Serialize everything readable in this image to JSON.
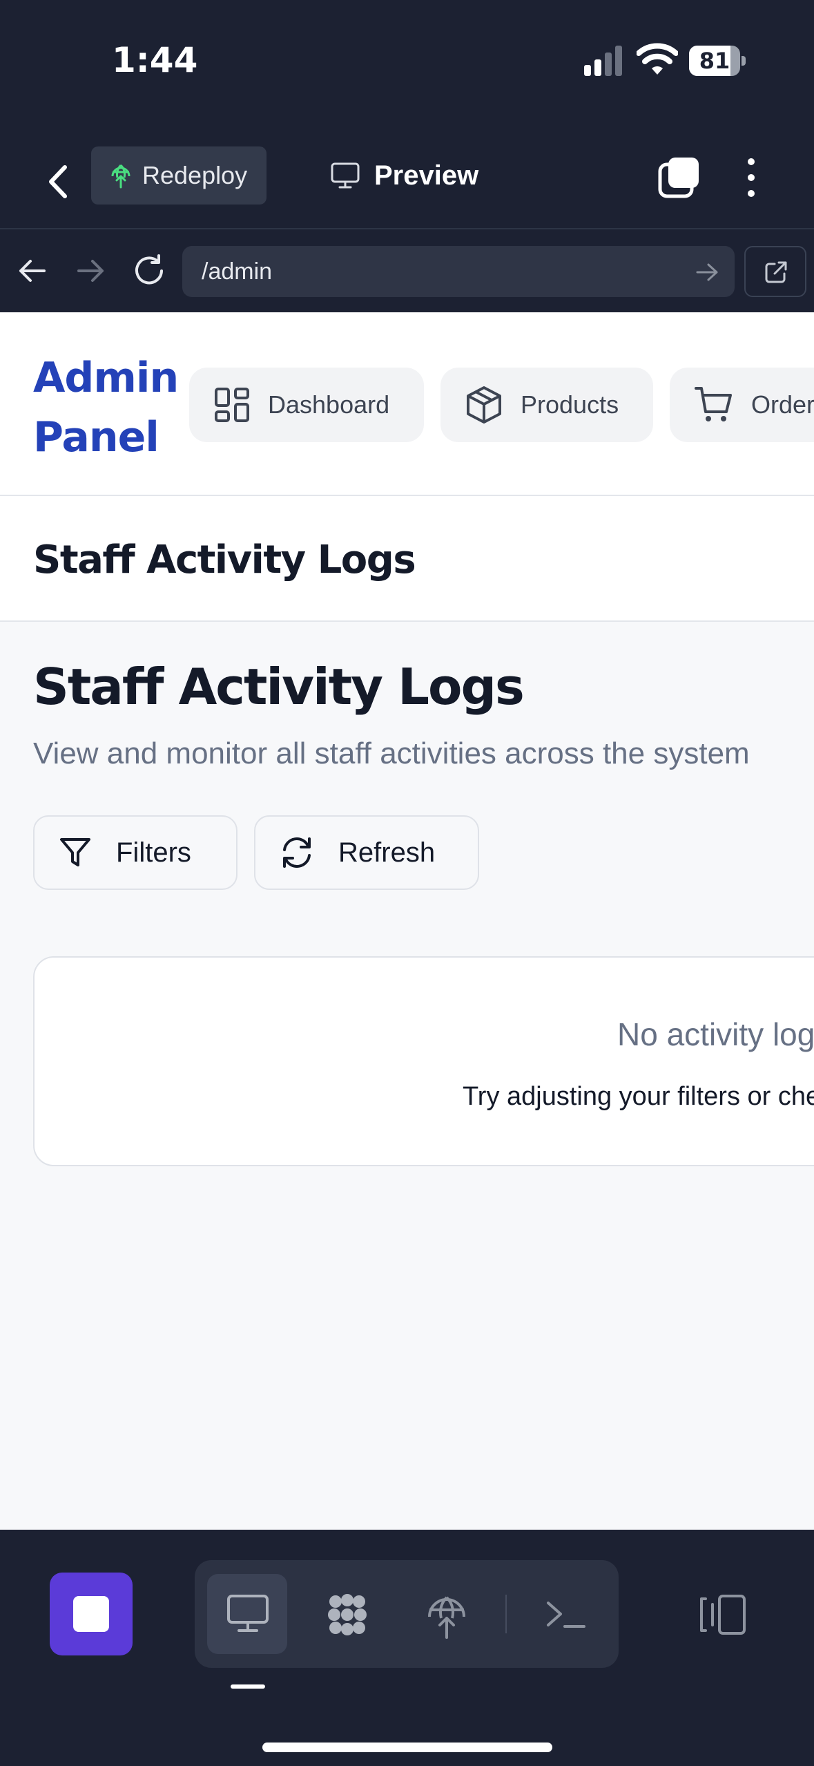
{
  "status_bar": {
    "time": "1:44",
    "battery": "81",
    "battery_level": 0.81
  },
  "toolbar": {
    "redeploy_label": "Redeploy",
    "preview_label": "Preview"
  },
  "browser": {
    "url": "/admin"
  },
  "site": {
    "brand_line1": "Admin",
    "brand_line2": "Panel",
    "nav": [
      {
        "label": "Dashboard",
        "icon": "dashboard-grid-icon"
      },
      {
        "label": "Products",
        "icon": "package-box-icon"
      },
      {
        "label": "Orders",
        "icon": "shopping-cart-icon"
      }
    ],
    "subheader_title": "Staff Activity Logs"
  },
  "page": {
    "title": "Staff Activity Logs",
    "description": "View and monitor all staff activities across the system",
    "actions": {
      "filters": "Filters",
      "refresh": "Refresh"
    },
    "empty": {
      "title": "No activity logs found",
      "hint": "Try adjusting your filters or check back later"
    }
  },
  "dock": {
    "items": [
      "monitor-icon",
      "agents-icon",
      "deploy-icon",
      "terminal-icon"
    ]
  },
  "colors": {
    "brand": "#2442b8",
    "dark_bg": "#1c2132",
    "stop_button": "#5b3bd8",
    "redeploy_icon": "#4ade80"
  }
}
